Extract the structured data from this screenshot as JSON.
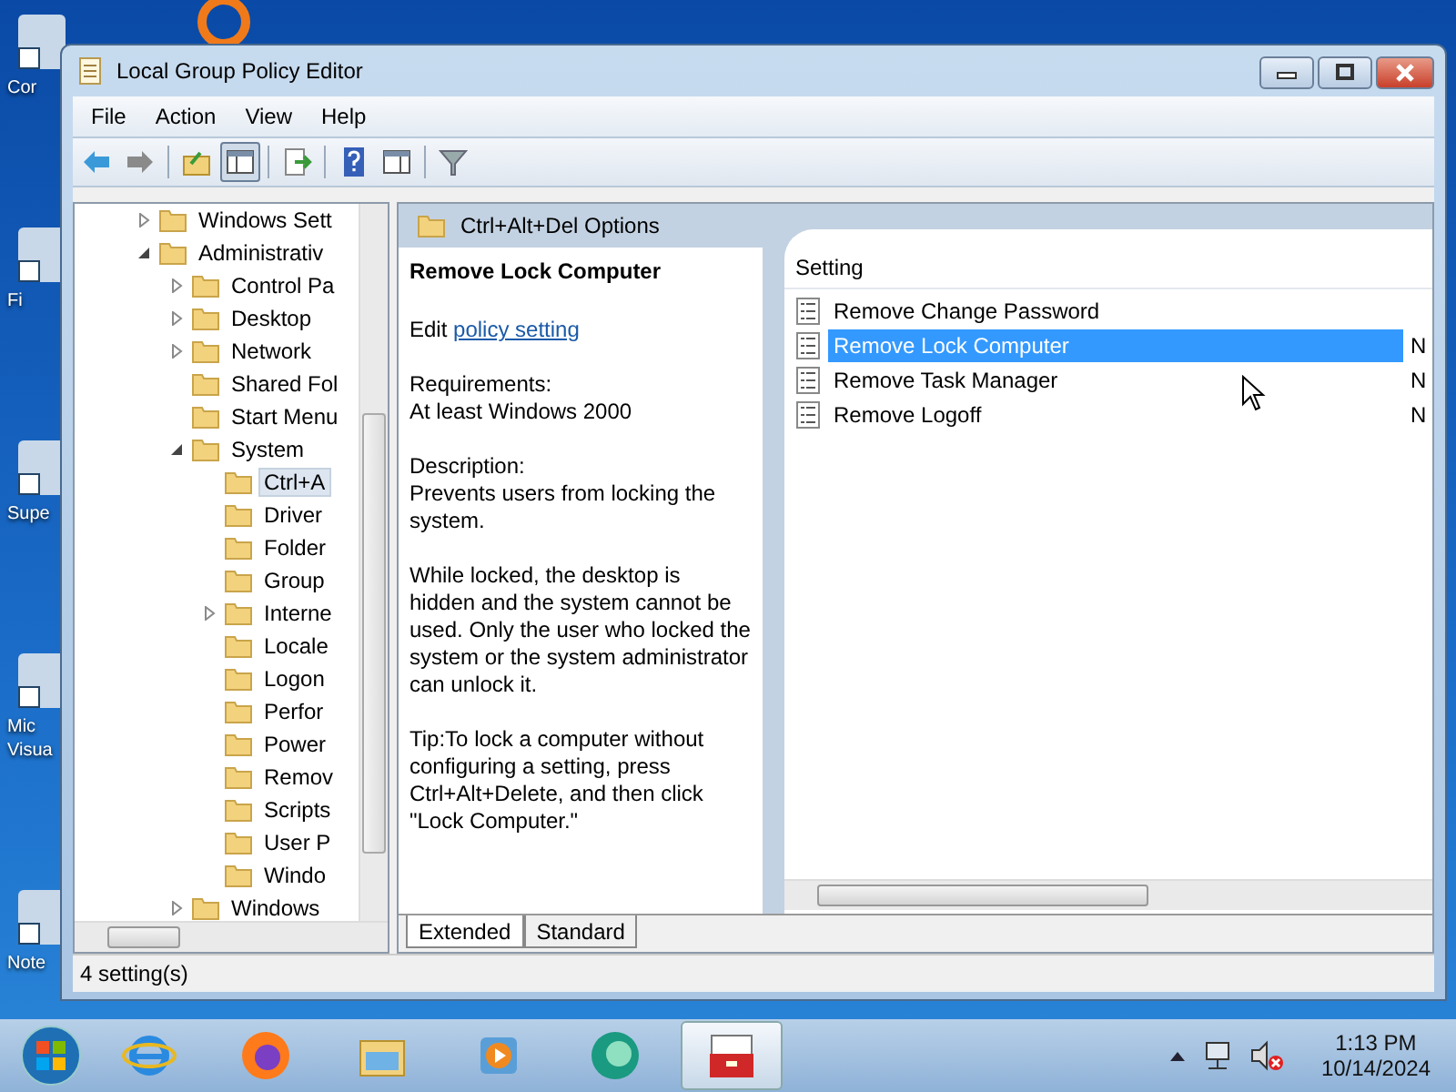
{
  "desktop_icons": [
    {
      "lines": [
        "Cor"
      ]
    },
    {
      "lines": [
        "Fi"
      ]
    },
    {
      "lines": [
        "Supe"
      ]
    },
    {
      "lines": [
        "Mic",
        "Visua"
      ]
    },
    {
      "lines": [
        "Note"
      ]
    }
  ],
  "window": {
    "title": "Local Group Policy Editor"
  },
  "menu": [
    "File",
    "Action",
    "View",
    "Help"
  ],
  "toolbar": [
    {
      "kind": "back",
      "pressed": false
    },
    {
      "kind": "forward",
      "pressed": false
    },
    {
      "kind": "up",
      "pressed": false
    },
    {
      "kind": "tree",
      "pressed": true
    },
    {
      "kind": "export",
      "pressed": false
    },
    {
      "kind": "help",
      "pressed": false
    },
    {
      "kind": "pane",
      "pressed": false
    },
    {
      "kind": "filter",
      "pressed": false
    }
  ],
  "tree": [
    {
      "label": "Windows Sett",
      "expanded": false,
      "selected": false
    },
    {
      "label": "Administrativ",
      "expanded": true,
      "selected": false,
      "children": [
        {
          "label": "Control Pa",
          "expanded": false,
          "selected": false
        },
        {
          "label": "Desktop",
          "expanded": false,
          "selected": false
        },
        {
          "label": "Network",
          "expanded": false,
          "selected": false
        },
        {
          "label": "Shared Fol",
          "selected": false
        },
        {
          "label": "Start Menu",
          "selected": false
        },
        {
          "label": "System",
          "expanded": true,
          "selected": false,
          "children": [
            {
              "label": "Ctrl+A",
              "selected": true
            },
            {
              "label": "Driver",
              "selected": false
            },
            {
              "label": "Folder",
              "selected": false
            },
            {
              "label": "Group",
              "selected": false
            },
            {
              "label": "Interne",
              "expanded": false,
              "selected": false
            },
            {
              "label": "Locale",
              "selected": false
            },
            {
              "label": "Logon",
              "selected": false
            },
            {
              "label": "Perfor",
              "selected": false
            },
            {
              "label": "Power",
              "selected": false
            },
            {
              "label": "Remov",
              "selected": false
            },
            {
              "label": "Scripts",
              "selected": false
            },
            {
              "label": "User P",
              "selected": false
            },
            {
              "label": "Windo",
              "selected": false
            }
          ]
        },
        {
          "label": "Windows",
          "expanded": false,
          "selected": false
        }
      ]
    }
  ],
  "details": {
    "header": "Ctrl+Alt+Del Options",
    "title": "Remove Lock Computer",
    "edit_prefix": "Edit",
    "edit_link": "policy setting",
    "sections": [
      {
        "heading": "Requirements:",
        "text": "At least Windows 2000"
      },
      {
        "heading": "Description:",
        "text": "Prevents users from locking the system."
      },
      {
        "text": "While locked, the desktop is hidden and the system cannot be used. Only the user who locked the system or the system administrator can unlock it."
      },
      {
        "text": "Tip:To lock a computer without configuring a setting, press Ctrl+Alt+Delete, and then click \"Lock Computer.\""
      }
    ]
  },
  "settings": {
    "column": "Setting",
    "rows": [
      {
        "name": "Remove Change Password",
        "selected": false
      },
      {
        "name": "Remove Lock Computer",
        "column_2": "N",
        "selected": true
      },
      {
        "name": "Remove Task Manager",
        "column_2": "N",
        "selected": false
      },
      {
        "name": "Remove Logoff",
        "column_2": "N",
        "selected": false
      }
    ]
  },
  "view_tabs": [
    {
      "label": "Extended",
      "selected": true
    },
    {
      "label": "Standard",
      "selected": false
    }
  ],
  "status_bar": "4 setting(s)",
  "taskbar": {
    "apps": [
      {
        "kind": "ie",
        "active": false
      },
      {
        "kind": "firefox",
        "active": false
      },
      {
        "kind": "explorer",
        "active": false
      },
      {
        "kind": "media",
        "active": false
      },
      {
        "kind": "disc",
        "active": false
      },
      {
        "kind": "toolbox",
        "active": true
      }
    ],
    "time": "1:13 PM",
    "date": "10/14/2024"
  }
}
